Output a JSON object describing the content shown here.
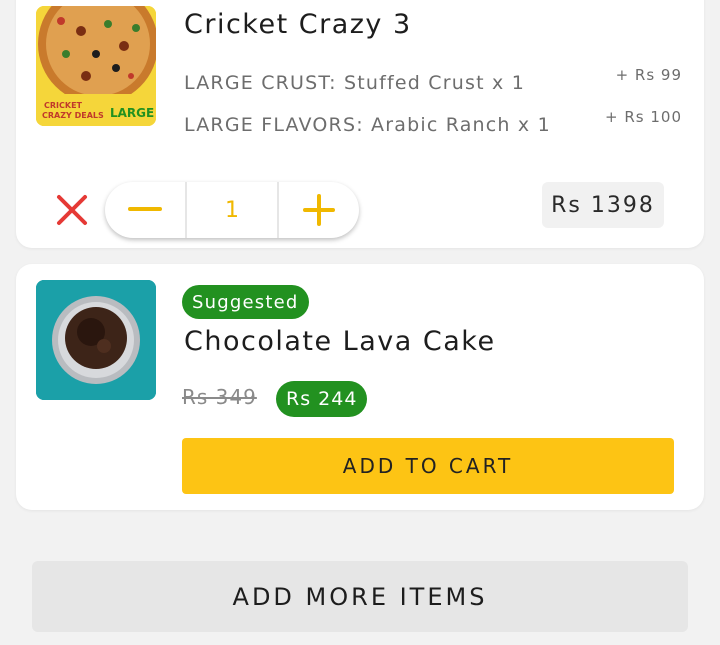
{
  "cart_item": {
    "title": "Cricket Crazy 3",
    "image_icon": "pizza-image",
    "image_text_line1": "CRICKET",
    "image_text_line2": "CRAZY DEALS",
    "image_text_large": "LARGE",
    "options": [
      {
        "label": "LARGE CRUST: Stuffed Crust x 1",
        "price": "+ Rs 99"
      },
      {
        "label": "LARGE FLAVORS: Arabic Ranch x 1",
        "price": "+ Rs 100"
      }
    ],
    "quantity": "1",
    "total": "Rs 1398",
    "remove_icon": "close-icon",
    "decrement_icon": "minus-icon",
    "increment_icon": "plus-icon"
  },
  "suggested_item": {
    "badge": "Suggested",
    "title": "Chocolate Lava Cake",
    "image_icon": "lava-cake-image",
    "old_price": "Rs 349",
    "new_price": "Rs 244",
    "add_to_cart_label": "ADD TO CART"
  },
  "footer": {
    "add_more_label": "ADD MORE ITEMS"
  },
  "colors": {
    "accent_yellow": "#fdc414",
    "remove_red": "#e53935",
    "suggested_green": "#229120",
    "card_bg": "#ffffff",
    "page_bg": "#f2f2f2"
  }
}
